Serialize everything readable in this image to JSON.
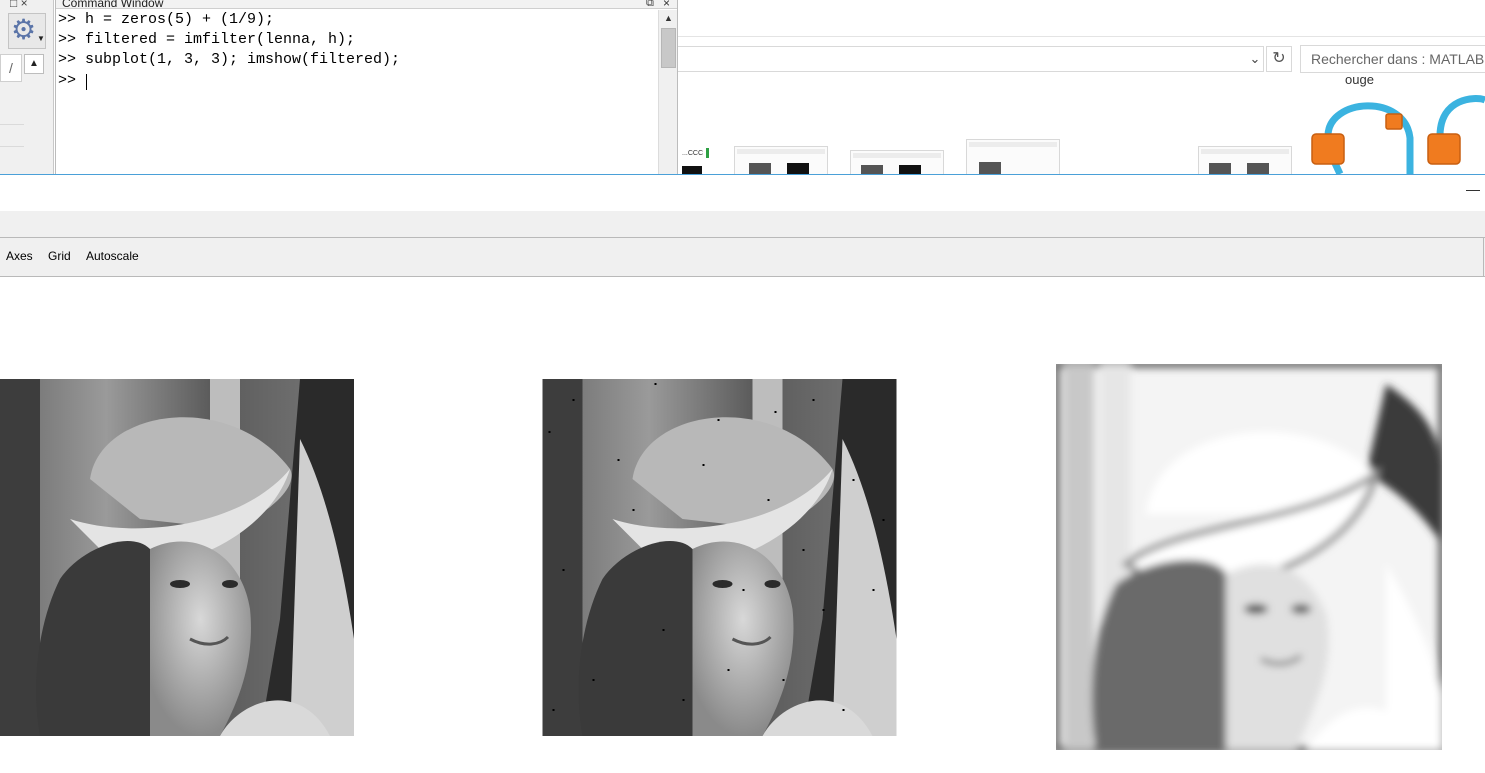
{
  "command_window": {
    "title": "Command Window",
    "lines": [
      ">> h = zeros(5) + (1/9);",
      ">> filtered = imfilter(lenna, h);",
      ">> subplot(1, 3, 3); imshow(filtered);",
      ">> "
    ]
  },
  "gutter": {
    "pencil_glyph": "/"
  },
  "explorer": {
    "search_placeholder": "Rechercher dans : MATLAB",
    "partial_label": "ouge",
    "thumb_label": "...CCC"
  },
  "figure": {
    "toolbar": {
      "axes_label": "Axes",
      "grid_label": "Grid",
      "autoscale_label": "Autoscale"
    },
    "images": [
      {
        "name": "original"
      },
      {
        "name": "noisy"
      },
      {
        "name": "filtered"
      }
    ]
  },
  "colors": {
    "accent_blue": "#4aa0d8",
    "orange": "#f07b1f",
    "cyan": "#3bb3e0",
    "panel_gray": "#f0f0f0"
  }
}
